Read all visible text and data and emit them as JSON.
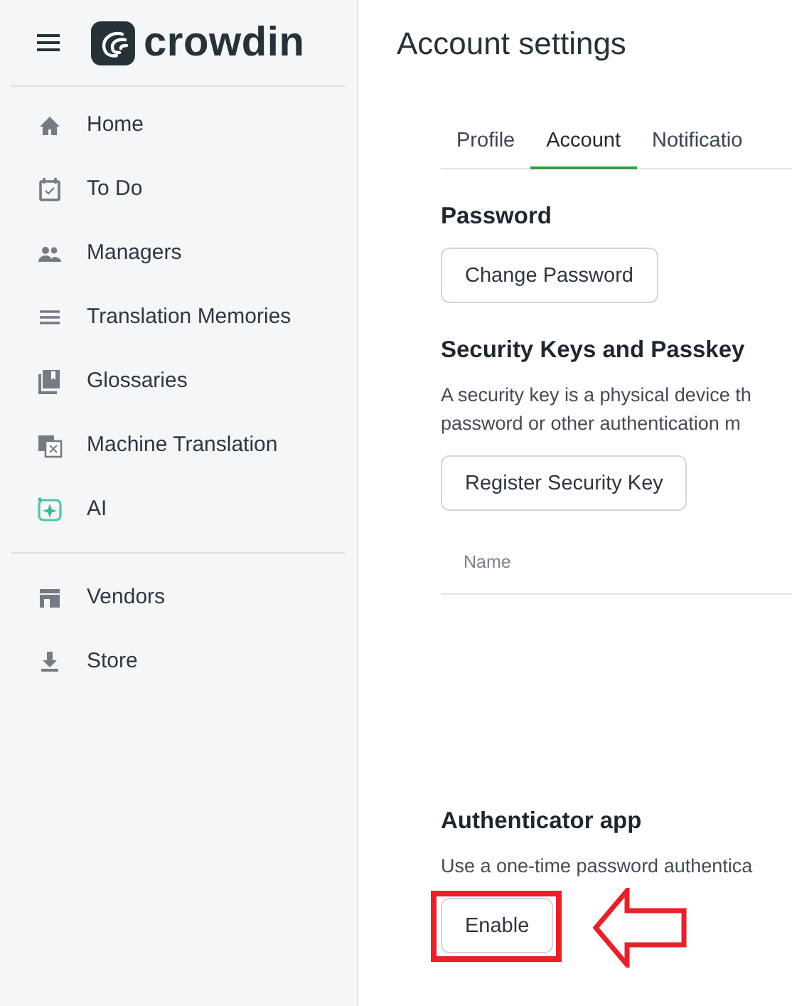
{
  "sidebar": {
    "logo": "crowdin",
    "groups": [
      {
        "items": [
          {
            "label": "Home"
          },
          {
            "label": "To Do"
          },
          {
            "label": "Managers"
          },
          {
            "label": "Translation Memories"
          },
          {
            "label": "Glossaries"
          },
          {
            "label": "Machine Translation"
          },
          {
            "label": "AI"
          }
        ]
      },
      {
        "items": [
          {
            "label": "Vendors"
          },
          {
            "label": "Store"
          }
        ]
      }
    ]
  },
  "page": {
    "title": "Account settings",
    "tabs": [
      {
        "label": "Profile",
        "selected": false
      },
      {
        "label": "Account",
        "selected": true
      },
      {
        "label": "Notificatio",
        "selected": false
      }
    ],
    "sections": [
      {
        "heading": "Password",
        "button": "Change Password"
      },
      {
        "heading": "Security Keys and Passkey",
        "description": [
          "A security key is a physical device th",
          "password or other authentication m"
        ],
        "button": "Register Security Key",
        "table_column": "Name"
      },
      {
        "heading": "Authenticator app",
        "description": [
          "Use a one-time password authentica"
        ],
        "button": "Enable",
        "highlighted": true
      }
    ]
  }
}
